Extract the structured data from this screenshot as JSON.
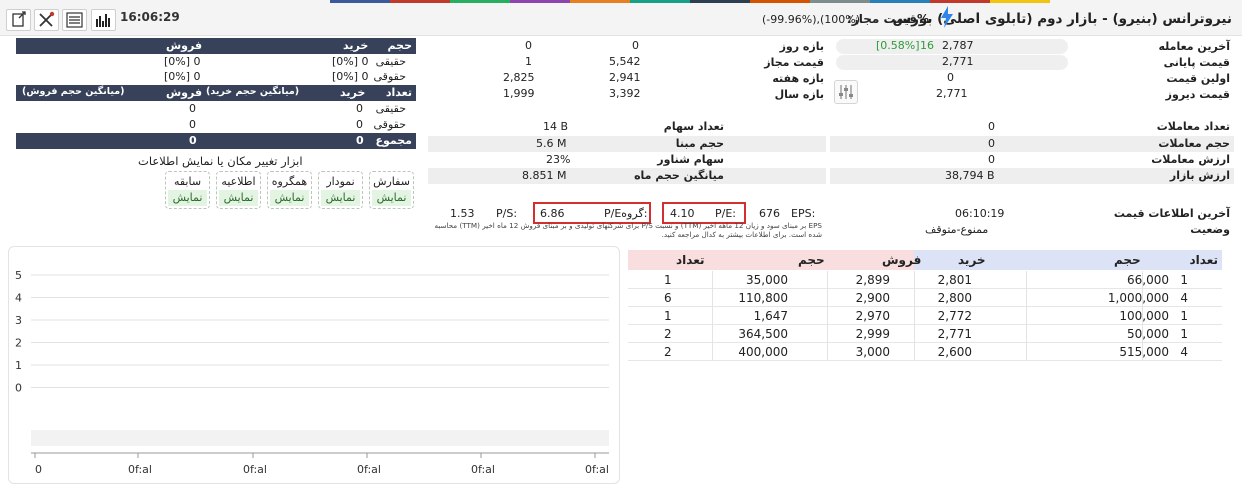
{
  "header": {
    "time": "16:06:29",
    "title": "نیروترانس (بنیرو) - بازار دوم (تابلوی اصلی) بورس",
    "allowed_label": "%قیمت مجاز:",
    "allowed_values": "(-99.96%),(100%)",
    "icons": [
      "chart-bars-icon",
      "list-icon",
      "tools-icon",
      "export-icon",
      "lightning-icon"
    ]
  },
  "order_book": {
    "head1": {
      "volume": "حجم",
      "buy": "خرید",
      "sell": "فروش"
    },
    "rows1": [
      {
        "label": "حقیقی",
        "buy": "[0%] 0",
        "sell": "[0%] 0"
      },
      {
        "label": "حقوقی",
        "buy": "[0%] 0",
        "sell": "[0%] 0"
      }
    ],
    "head2": {
      "count": "تعداد",
      "buy": "خرید",
      "avg_buy": "(میانگین حجم خرید)",
      "sell": "فروش",
      "avg_sell": "(میانگین حجم فروش)"
    },
    "rows2": [
      {
        "label": "حقیقی",
        "buy": "0",
        "sell": "0"
      },
      {
        "label": "حقوقی",
        "buy": "0",
        "sell": "0"
      }
    ],
    "total": {
      "label": "مجموع",
      "buy": "0",
      "sell": "0"
    }
  },
  "tools": {
    "title": "ابزار تغییر مکان یا نمایش اطلاعات",
    "items": [
      {
        "label": "سفارش",
        "action": "نمایش"
      },
      {
        "label": "نمودار",
        "action": "نمایش"
      },
      {
        "label": "همگروه",
        "action": "نمایش"
      },
      {
        "label": "اطلاعیه",
        "action": "نمایش"
      },
      {
        "label": "سابقه",
        "action": "نمایش"
      }
    ]
  },
  "prices": [
    {
      "label": "آخرین معامله",
      "value": "2,787",
      "change": "16",
      "percent": "[0.58%]"
    },
    {
      "label": "قیمت پایانی",
      "value": "2,771"
    },
    {
      "label": "اولین قیمت",
      "value": "0"
    },
    {
      "label": "قیمت دیروز",
      "value": "2,771"
    }
  ],
  "ranges": [
    {
      "label": "بازه روز",
      "low": "0",
      "high": "0"
    },
    {
      "label": "قیمت مجاز",
      "low": "1",
      "high": "5,542"
    },
    {
      "label": "بازه هفته",
      "low": "2,825",
      "high": "2,941"
    },
    {
      "label": "بازه سال",
      "low": "1,999",
      "high": "3,392"
    }
  ],
  "stats_right": [
    {
      "label": "تعداد معاملات",
      "value": "0"
    },
    {
      "label": "حجم معاملات",
      "value": "0"
    },
    {
      "label": "ارزش معاملات",
      "value": "0"
    },
    {
      "label": "ارزش بازار",
      "value": "38,794 B"
    }
  ],
  "stats_mid": [
    {
      "label": "تعداد سهام",
      "value": "14 B"
    },
    {
      "label": "حجم مبنا",
      "value": "5.6 M"
    },
    {
      "label": "سهام شناور",
      "value": "23%"
    },
    {
      "label": "میانگین حجم ماه",
      "value": "8.851 M"
    }
  ],
  "ratios": {
    "eps_label": "EPS:",
    "eps": "676",
    "pe_label": "P/E:",
    "pe": "4.10",
    "group_pe_label": "P/Eگروه:",
    "group_pe": "6.86",
    "ps_label": "P/S:",
    "ps": "1.53",
    "note": "EPS بر مبنای سود و زیان 12 ماهه اخیر (TTM) و نسبت P/S برای شرکتهای تولیدی و بر مبنای فروش 12 ماه اخیر (TTM) محاسبه شده است. برای اطلاعات بیشتر به کدال مراجعه کنید."
  },
  "last_info": {
    "label": "آخرین اطلاعات قیمت",
    "value": "06:10:19"
  },
  "status": {
    "label": "وضعیت",
    "value": "ممنوع-متوقف"
  },
  "trades": {
    "headers": [
      "تعداد",
      "حجم",
      "خرید",
      "فروش",
      "حجم",
      "تعداد"
    ],
    "rows": [
      [
        "1",
        "66,000",
        "2,801",
        "2,899",
        "35,000",
        "1"
      ],
      [
        "4",
        "1,000,000",
        "2,800",
        "2,900",
        "110,800",
        "6"
      ],
      [
        "1",
        "100,000",
        "2,772",
        "2,970",
        "1,647",
        "1"
      ],
      [
        "1",
        "50,000",
        "2,771",
        "2,999",
        "364,500",
        "2"
      ],
      [
        "4",
        "515,000",
        "2,600",
        "3,000",
        "400,000",
        "2"
      ]
    ],
    "colors": {
      "buy_header": "#dde3f7",
      "sell_header": "#f8dede"
    }
  },
  "chart": {
    "y_ticks": [
      "5",
      "4",
      "3",
      "2",
      "1",
      "0"
    ],
    "x_ticks": [
      "0",
      "0f:al",
      "0f:al",
      "0f:al",
      "0f:al",
      "0f:al"
    ]
  }
}
